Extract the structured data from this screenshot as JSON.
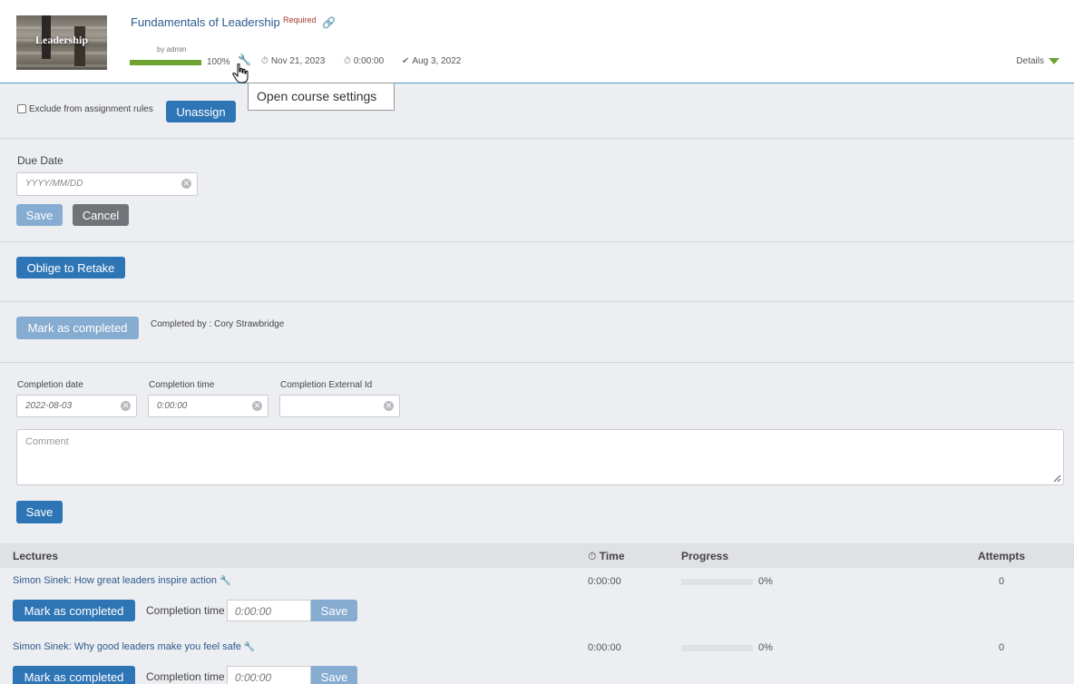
{
  "course": {
    "thumbnail_text": "Leadership",
    "title": "Fundamentals of Leadership",
    "required": "Required",
    "author": "by admin",
    "progress_pct": "100%",
    "progress_value": 1.0,
    "start_date": "Nov 21, 2023",
    "duration": "0:00:00",
    "completed_date": "Aug 3, 2022",
    "details_label": "Details"
  },
  "tooltip": "Open course settings",
  "assignment": {
    "exclude_label": "Exclude from assignment rules",
    "unassign_label": "Unassign"
  },
  "due_date": {
    "label": "Due Date",
    "placeholder": "YYYY/MM/DD",
    "save_label": "Save",
    "cancel_label": "Cancel"
  },
  "retake": {
    "button_label": "Oblige to Retake"
  },
  "completion": {
    "mark_label": "Mark as completed",
    "completed_by": "Completed by : Cory Strawbridge",
    "date_label": "Completion date",
    "date_value": "2022-08-03",
    "time_label": "Completion time",
    "time_value": "0:00:00",
    "external_id_label": "Completion External Id",
    "comment_placeholder": "Comment",
    "save_label": "Save"
  },
  "lectures": {
    "headers": {
      "lectures": "Lectures",
      "time": "Time",
      "progress": "Progress",
      "attempts": "Attempts"
    },
    "items": [
      {
        "title": "Simon Sinek: How great leaders inspire action",
        "time": "0:00:00",
        "progress": "0%",
        "attempts": "0",
        "mark_label": "Mark as completed",
        "completion_time_label": "Completion time",
        "completion_time_value": "0:00:00",
        "save_label": "Save"
      },
      {
        "title": "Simon Sinek: Why good leaders make you feel safe",
        "time": "0:00:00",
        "progress": "0%",
        "attempts": "0",
        "mark_label": "Mark as completed",
        "completion_time_label": "Completion time",
        "completion_time_value": "0:00:00",
        "save_label": "Save"
      }
    ]
  },
  "icons": {
    "link": "link-icon",
    "wrench": "wrench-icon",
    "start": "stopwatch-icon",
    "duration": "timer-icon",
    "completed": "checkmark-icon",
    "details": "triangle-down-icon",
    "clear": "clear-icon"
  },
  "colors": {
    "primary_button": "#2e75b5",
    "disabled_button": "#87acd1",
    "cancel_button": "#6f7478",
    "progress_green": "#6ea331",
    "title_blue": "#2d5a8e",
    "required_red": "#a0392d"
  }
}
